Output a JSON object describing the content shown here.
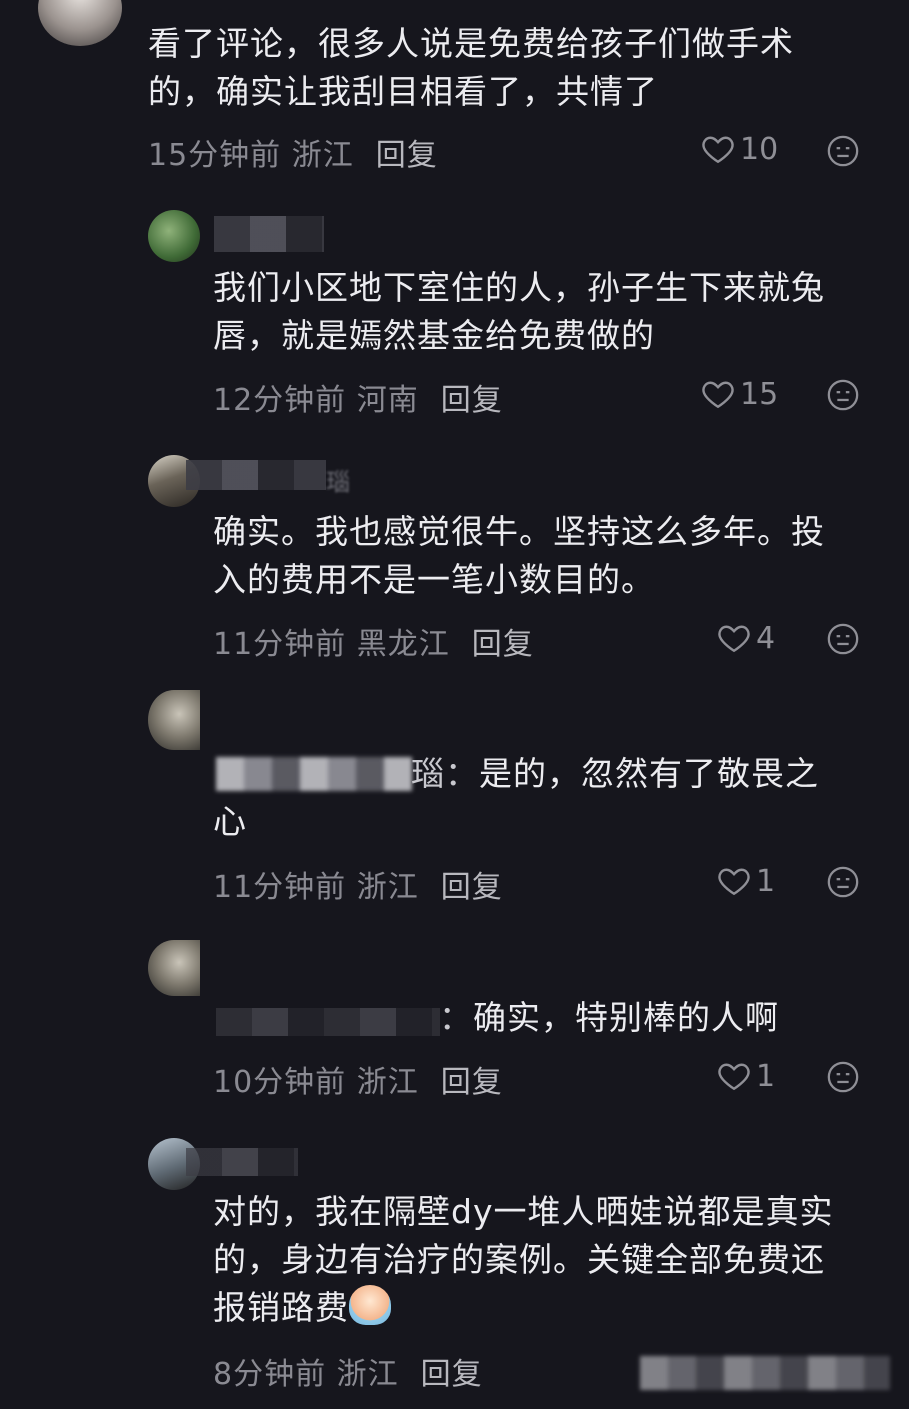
{
  "comments": [
    {
      "text": "看了评论，很多人说是免费给孩子们做手术的，确实让我刮目相看了，共情了",
      "line1": "看了评论，很多人说是免费给孩子们做手术",
      "line2": "的，确实让我刮目相看了，共情了",
      "time_location": "15分钟前 浙江",
      "reply": "回复",
      "likes": "10"
    },
    {
      "line1": "我们小区地下室住的人，孙子生下来就兔",
      "line2": "唇，就是嫣然基金给免费做的",
      "time_location": "12分钟前 河南",
      "reply": "回复",
      "likes": "15"
    },
    {
      "user_partial": "瑙",
      "line1": "确实。我也感觉很牛。坚持这么多年。投",
      "line2": "入的费用不是一笔小数目的。",
      "time_location": "11分钟前 黑龙江",
      "reply": "回复",
      "likes": "4"
    },
    {
      "mention_tail": "瑙：",
      "line1": "是的，忽然有了敬畏之",
      "line2": "心",
      "time_location": "11分钟前 浙江",
      "reply": "回复",
      "likes": "1"
    },
    {
      "mention_tail": "：",
      "line1": "确实，特别棒的人啊",
      "time_location": "10分钟前 浙江",
      "reply": "回复",
      "likes": "1"
    },
    {
      "line1": "对的，我在隔壁dy一堆人晒娃说都是真实",
      "line2": "的，身边有治疗的案例。关键全部免费还",
      "line3": "报销路费",
      "time_location": "8分钟前 浙江",
      "reply": "回复"
    }
  ],
  "icons": {
    "like": "heart-outline-icon",
    "dislike": "neutral-face-icon"
  },
  "colors": {
    "background": "#16161d",
    "text": "#ececf0",
    "meta": "#8a8a92"
  }
}
